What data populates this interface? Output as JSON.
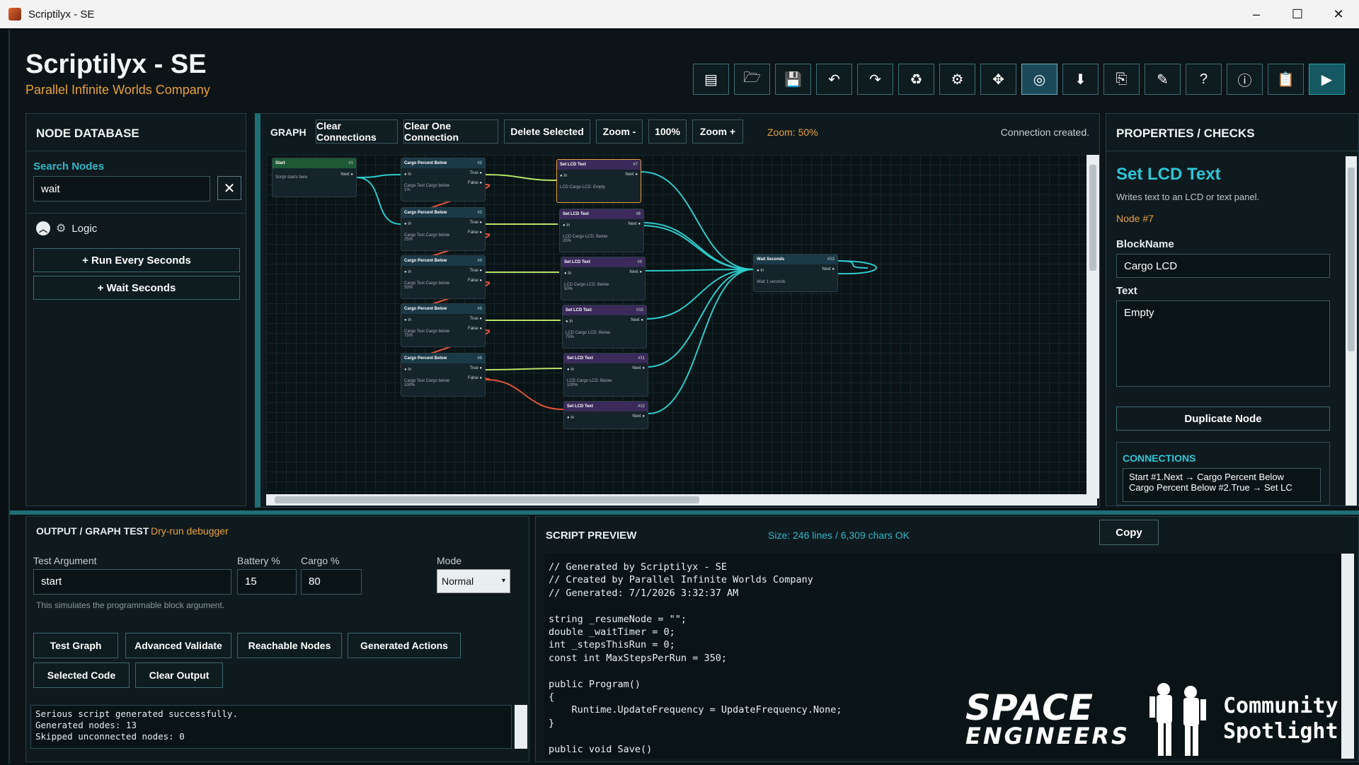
{
  "window": {
    "title": "Scriptilyx - SE",
    "min": "–",
    "max": "☐",
    "close": "✕"
  },
  "brand": {
    "title": "Scriptilyx - SE",
    "subtitle": "Parallel Infinite Worlds Company"
  },
  "toolbar": [
    {
      "name": "new-icon",
      "glyph": "▤"
    },
    {
      "name": "open-folder-icon",
      "glyph": "🗁"
    },
    {
      "name": "save-icon",
      "glyph": "💾"
    },
    {
      "name": "undo-icon",
      "glyph": "↶"
    },
    {
      "name": "redo-icon",
      "glyph": "↷"
    },
    {
      "name": "recycle-icon",
      "glyph": "♻"
    },
    {
      "name": "brain-icon",
      "glyph": "⚙"
    },
    {
      "name": "puzzle-icon",
      "glyph": "✥"
    },
    {
      "name": "hover-icon",
      "glyph": "◎"
    },
    {
      "name": "download-icon",
      "glyph": "⬇"
    },
    {
      "name": "export-icon",
      "glyph": "⎘"
    },
    {
      "name": "wizard-icon",
      "glyph": "✎"
    },
    {
      "name": "help-icon",
      "glyph": "?"
    },
    {
      "name": "info-icon",
      "glyph": "ⓘ"
    },
    {
      "name": "clipboard-icon",
      "glyph": "📋"
    },
    {
      "name": "run-icon",
      "glyph": "▶"
    }
  ],
  "nodedb": {
    "title": "NODE DATABASE",
    "search_label": "Search Nodes",
    "search_value": "wait",
    "clear_glyph": "✕",
    "category": "Logic",
    "chev_glyph": "︿",
    "items": [
      "+ Run Every Seconds",
      "+ Wait Seconds"
    ]
  },
  "graph": {
    "title": "GRAPH",
    "buttons": [
      "Clear Connections",
      "Clear One Connection",
      "Delete Selected",
      "Zoom -",
      "100%",
      "Zoom +"
    ],
    "zoom": "Zoom: 50%",
    "status": "Connection created.",
    "nodes": [
      {
        "title": "Start",
        "id": "#1",
        "out": "Next",
        "body": "Script starts here"
      },
      {
        "title": "Cargo Percent Below",
        "id": "#2",
        "t": "True",
        "f": "False",
        "in": "In",
        "body": "Cargo Test Cargo below 1%"
      },
      {
        "title": "Cargo Percent Below",
        "id": "#3",
        "t": "True",
        "f": "False",
        "in": "In",
        "body": "Cargo Test Cargo below 25%"
      },
      {
        "title": "Cargo Percent Below",
        "id": "#4",
        "t": "True",
        "f": "False",
        "in": "In",
        "body": "Cargo Test Cargo below 50%"
      },
      {
        "title": "Cargo Percent Below",
        "id": "#5",
        "t": "True",
        "f": "False",
        "in": "In",
        "body": "Cargo Test Cargo below 75%"
      },
      {
        "title": "Cargo Percent Below",
        "id": "#6",
        "t": "True",
        "f": "False",
        "in": "In",
        "body": "Cargo Test Cargo below 100%"
      },
      {
        "title": "Set LCD Text",
        "id": "#7",
        "in": "In",
        "out": "Next",
        "body": "LCD Cargo LCD: Empty"
      },
      {
        "title": "Set LCD Text",
        "id": "#8",
        "in": "In",
        "out": "Next",
        "body": "LCD Cargo LCD: Below 25%"
      },
      {
        "title": "Set LCD Text",
        "id": "#9",
        "in": "In",
        "out": "Next",
        "body": "LCD Cargo LCD: Below 50%"
      },
      {
        "title": "Set LCD Text",
        "id": "#10",
        "in": "In",
        "out": "Next",
        "body": "LCD Cargo LCD: Below 75%"
      },
      {
        "title": "Set LCD Text",
        "id": "#11",
        "in": "In",
        "out": "Next",
        "body": "LCD Cargo LCD: Below 100%"
      },
      {
        "title": "Set LCD Text",
        "id": "#12",
        "in": "In",
        "out": "Next",
        "body": ""
      },
      {
        "title": "Wait Seconds",
        "id": "#13",
        "in": "In",
        "out": "Next",
        "body": "Wait 1 seconds"
      }
    ]
  },
  "props": {
    "title": "PROPERTIES / CHECKS",
    "node_title": "Set LCD Text",
    "desc": "Writes text to an LCD or text panel.",
    "node_id": "Node #7",
    "blockname_label": "BlockName",
    "blockname_value": "Cargo LCD",
    "text_label": "Text",
    "text_value": "Empty",
    "duplicate": "Duplicate Node",
    "conn_title": "CONNECTIONS",
    "conn_items": [
      "Start #1.Next → Cargo Percent Below",
      "Cargo Percent Below #2.True → Set LC"
    ]
  },
  "output": {
    "title": "OUTPUT / GRAPH TEST",
    "subtitle": "Dry-run debugger",
    "arg_label": "Test Argument",
    "arg_value": "start",
    "battery_label": "Battery %",
    "battery_value": "15",
    "cargo_label": "Cargo %",
    "cargo_value": "80",
    "mode_label": "Mode",
    "mode_value": "Normal",
    "note": "This simulates the programmable block argument.",
    "buttons": [
      "Test Graph",
      "Advanced Validate",
      "Reachable Nodes",
      "Generated Actions",
      "Selected Code",
      "Clear Output"
    ],
    "log": [
      "Serious script generated successfully.",
      "Generated nodes: 13",
      "Skipped unconnected nodes: 0"
    ]
  },
  "script": {
    "title": "SCRIPT PREVIEW",
    "size": "Size: 246 lines / 6,309 chars  OK",
    "copy": "Copy",
    "code": "// Generated by Scriptilyx - SE\n// Created by Parallel Infinite Worlds Company\n// Generated: 7/1/2026 3:32:37 AM\n\nstring _resumeNode = \"\";\ndouble _waitTimer = 0;\nint _stepsThisRun = 0;\nconst int MaxStepsPerRun = 350;\n\npublic Program()\n{\n    Runtime.UpdateFrequency = UpdateFrequency.None;\n}\n\npublic void Save()"
  },
  "spotlight": {
    "logo_a": "SPACE",
    "logo_b": "ENGINEERS",
    "line1": "Community",
    "line2": "Spotlight"
  },
  "colors": {
    "accent": "#2fc6d6",
    "orange": "#e8a03c",
    "wire_teal": "#2ec9c9",
    "wire_green": "#b6e26a",
    "wire_red": "#e0553a",
    "node_green": "#1d3a2c",
    "node_purple": "#2e2440"
  }
}
